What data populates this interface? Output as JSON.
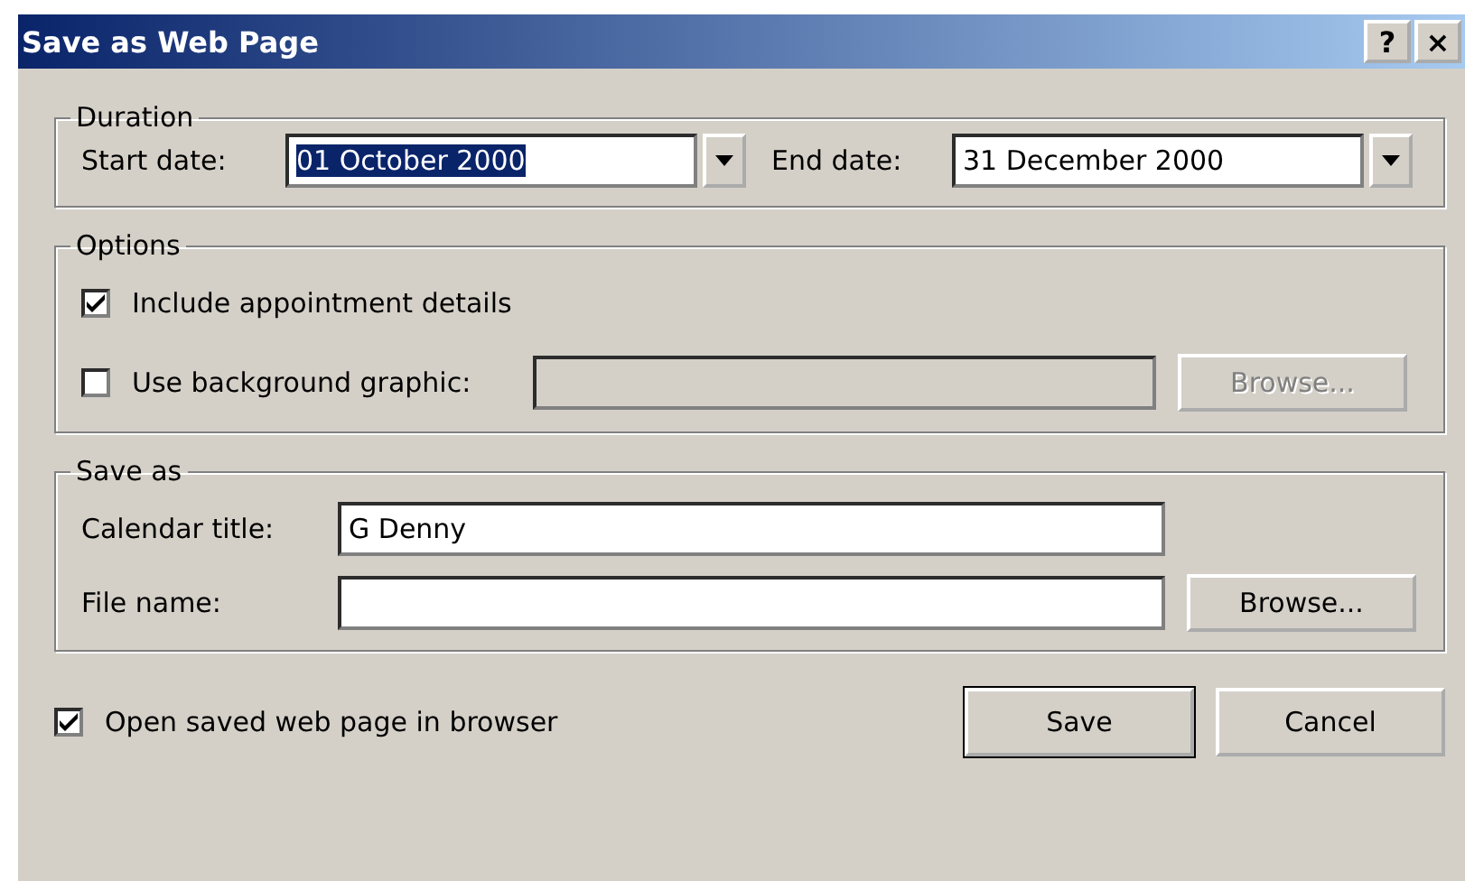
{
  "window": {
    "title": "Save as Web Page",
    "help_button": "?",
    "close_button": "×"
  },
  "duration": {
    "legend": "Duration",
    "start": {
      "label": "Start date:",
      "value": "01 October 2000",
      "selected": true
    },
    "end": {
      "label": "End date:",
      "value": "31 December 2000",
      "selected": false
    }
  },
  "options": {
    "legend": "Options",
    "include_details": {
      "label": "Include appointment details",
      "checked": true
    },
    "background": {
      "label": "Use background graphic:",
      "checked": false,
      "field_disabled": true,
      "browse": {
        "label": "Browse...",
        "disabled": true
      }
    }
  },
  "save_as": {
    "legend": "Save as",
    "calendar_title": {
      "label": "Calendar title:",
      "value": "G Denny"
    },
    "file_name": {
      "label": "File name:",
      "browse": {
        "label": "Browse...",
        "disabled": false
      }
    }
  },
  "open_in_browser": {
    "label": "Open saved web page in browser",
    "checked": true
  },
  "buttons": [
    {
      "label": "Save",
      "default": true
    },
    {
      "label": "Cancel",
      "default": false
    }
  ]
}
